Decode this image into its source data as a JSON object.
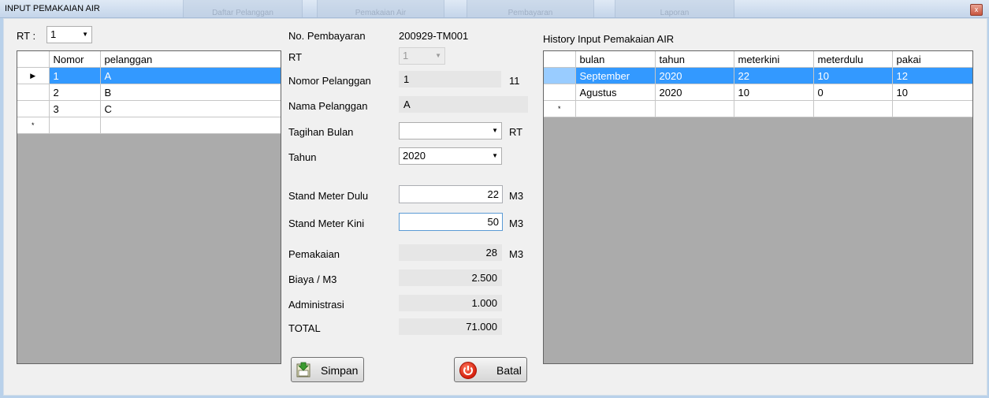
{
  "window": {
    "title": "INPUT PEMAKAIAN AIR",
    "close_glyph": "x",
    "ghost_tabs": [
      "Daftar Pelanggan",
      "Pemakaian Air",
      "Pembayaran",
      "Laporan"
    ]
  },
  "left": {
    "rt_label": "RT :",
    "rt_value": "1",
    "grid": {
      "columns": [
        "Nomor",
        "pelanggan"
      ],
      "rows": [
        {
          "nomor": "1",
          "pelanggan": "A",
          "selected": true
        },
        {
          "nomor": "2",
          "pelanggan": "B",
          "selected": false
        },
        {
          "nomor": "3",
          "pelanggan": "C",
          "selected": false
        }
      ],
      "selected_marker": "▶",
      "new_row_marker": "*"
    }
  },
  "form": {
    "no_pembayaran_label": "No. Pembayaran",
    "no_pembayaran_value": "200929-TM001",
    "rt_label": "RT",
    "rt_value": "1",
    "nomor_pelanggan_label": "Nomor Pelanggan",
    "nomor_pelanggan_value": "1",
    "nomor_pelanggan_extra": "11",
    "nama_pelanggan_label": "Nama Pelanggan",
    "nama_pelanggan_value": "A",
    "tagihan_bulan_label": "Tagihan Bulan",
    "tagihan_bulan_value": "",
    "tagihan_bulan_suffix": "RT",
    "tahun_label": "Tahun",
    "tahun_value": "2020",
    "stand_dulu_label": "Stand Meter Dulu",
    "stand_dulu_value": "22",
    "stand_kini_label": "Stand Meter Kini",
    "stand_kini_value": "50",
    "unit": "M3",
    "pemakaian_label": "Pemakaian",
    "pemakaian_value": "28",
    "biaya_label": "Biaya / M3",
    "biaya_value": "2.500",
    "administrasi_label": "Administrasi",
    "administrasi_value": "1.000",
    "total_label": "TOTAL",
    "total_value": "71.000",
    "save_label": "Simpan",
    "cancel_label": "Batal"
  },
  "history": {
    "title": "History Input Pemakaian AIR",
    "columns": [
      "bulan",
      "tahun",
      "meterkini",
      "meterdulu",
      "pakai"
    ],
    "rows": [
      {
        "bulan": "September",
        "tahun": "2020",
        "meterkini": "22",
        "meterdulu": "10",
        "pakai": "12",
        "selected": true
      },
      {
        "bulan": "Agustus",
        "tahun": "2020",
        "meterkini": "10",
        "meterdulu": "0",
        "pakai": "10",
        "selected": false
      }
    ],
    "new_row_marker": "*"
  },
  "colors": {
    "selection": "#3399ff",
    "grid_background": "#ababab",
    "window_frame": "#b9d1ea"
  }
}
